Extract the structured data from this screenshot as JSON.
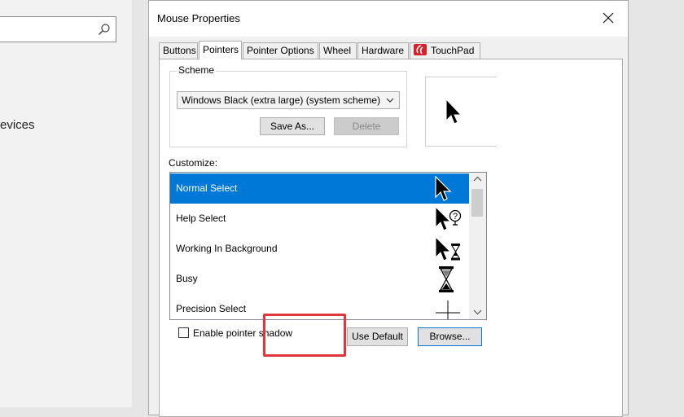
{
  "background": {
    "sidebar_text": "evices",
    "search_icon": "search-icon"
  },
  "dialog": {
    "title": "Mouse Properties",
    "close_icon": "close-icon",
    "tabs": [
      {
        "label": "Buttons",
        "active": false
      },
      {
        "label": "Pointers",
        "active": true
      },
      {
        "label": "Pointer Options",
        "active": false
      },
      {
        "label": "Wheel",
        "active": false
      },
      {
        "label": "Hardware",
        "active": false
      },
      {
        "label": "TouchPad",
        "active": false,
        "icon": "touchpad-logo-icon"
      }
    ],
    "scheme": {
      "legend": "Scheme",
      "selected": "Windows Black (extra large) (system scheme)",
      "save_as_label": "Save As...",
      "delete_label": "Delete"
    },
    "customize": {
      "label": "Customize:",
      "items": [
        {
          "label": "Normal Select",
          "icon": "arrow-cursor-icon",
          "selected": true
        },
        {
          "label": "Help Select",
          "icon": "help-cursor-icon",
          "selected": false
        },
        {
          "label": "Working In Background",
          "icon": "working-cursor-icon",
          "selected": false
        },
        {
          "label": "Busy",
          "icon": "hourglass-cursor-icon",
          "selected": false
        },
        {
          "label": "Precision Select",
          "icon": "crosshair-cursor-icon",
          "selected": false
        }
      ]
    },
    "shadow_label": "Enable pointer shadow",
    "shadow_checked": false,
    "use_default_label": "Use Default",
    "browse_label": "Browse..."
  },
  "colors": {
    "selection": "#0078d7",
    "highlight_box": "#e0353a"
  }
}
